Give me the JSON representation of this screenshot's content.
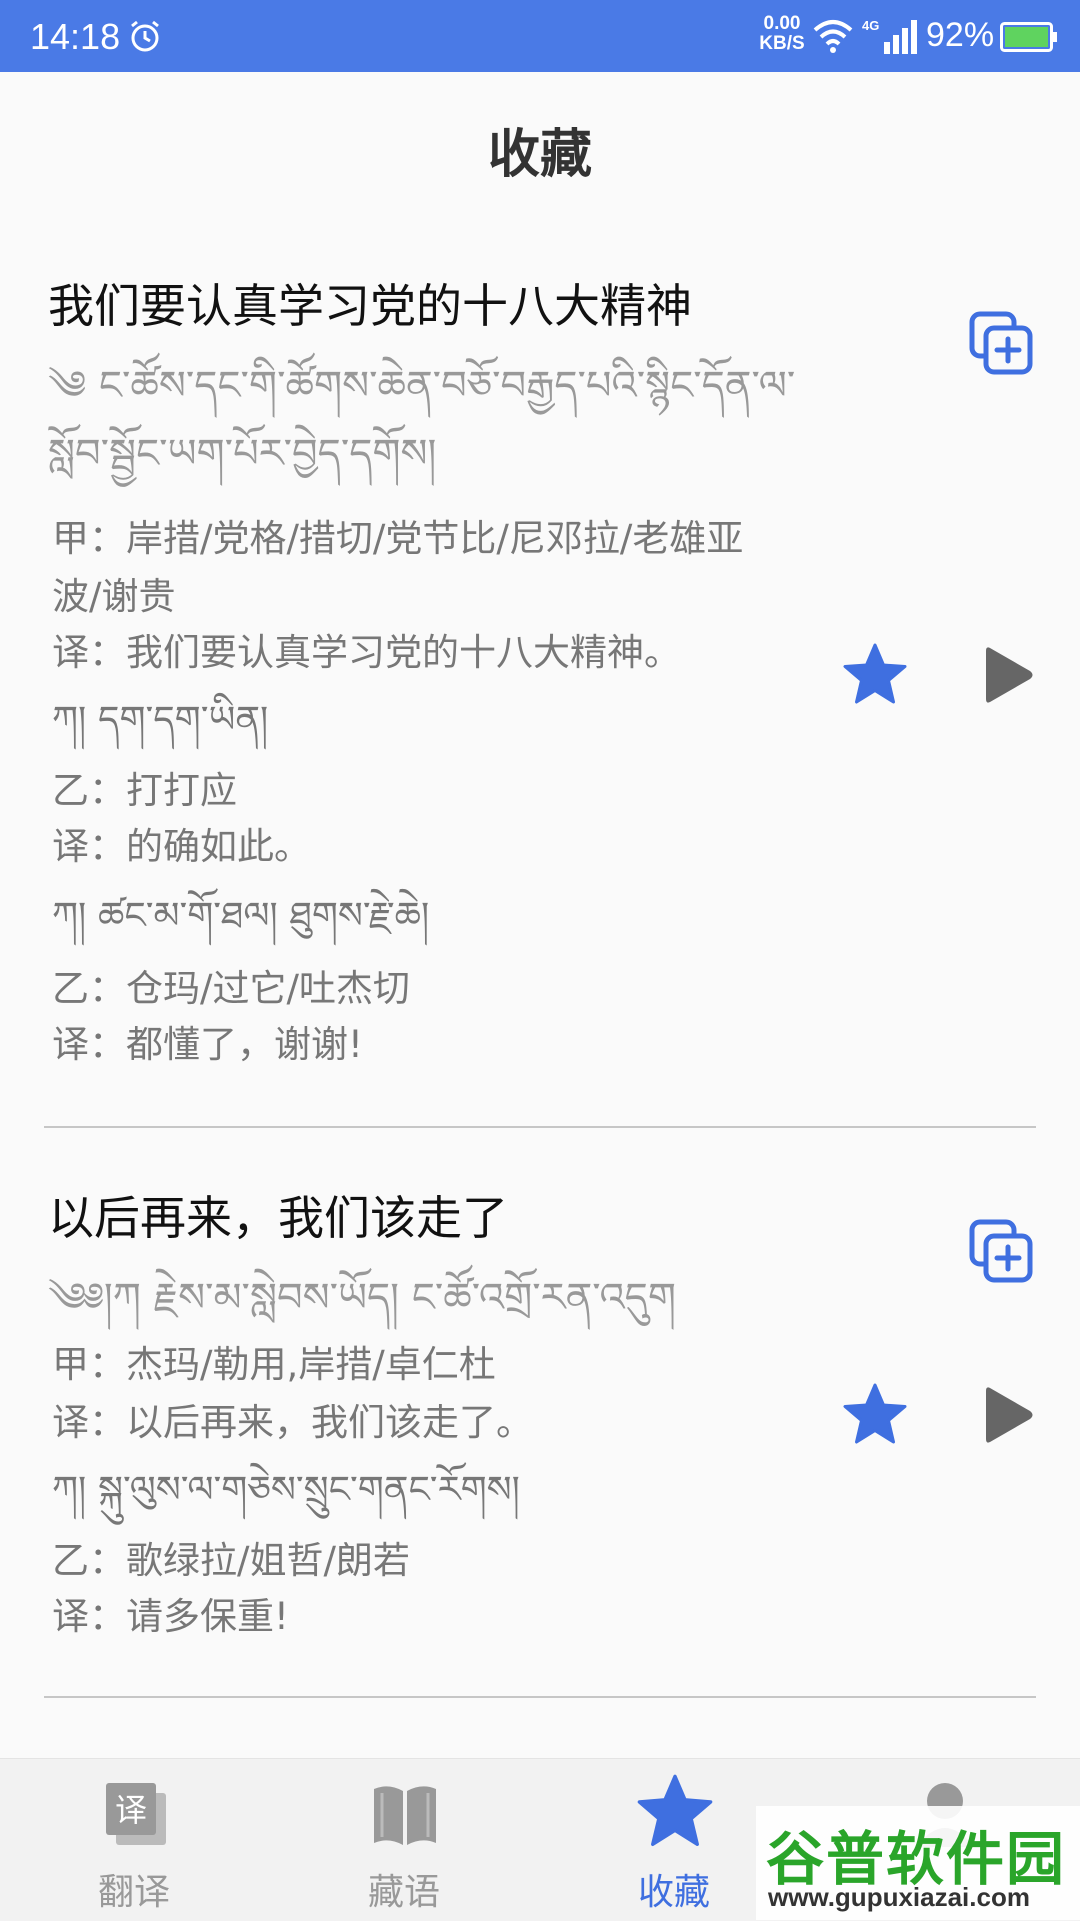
{
  "status_bar": {
    "time": "14:18",
    "net_speed_value": "0.00",
    "net_speed_unit": "KB/S",
    "battery": "92%"
  },
  "page": {
    "title": "收藏"
  },
  "items": [
    {
      "title": "我们要认真学习党的十八大精神",
      "tibetan_title_1": "༄   ང་ཚོས་དང་གི་ཚོགས་ཆེན་བཅོ་བརྒྱད་པའི་སྙིང་དོན་ལ་",
      "tibetan_title_2": "སློབ་སྦྱོང་ཡག་པོར་བྱེད་དགོས།",
      "lines": [
        "甲：岸措/党格/措切/党节比/尼邓拉/老雄亚",
        "波/谢贵",
        "译：我们要认真学习党的十八大精神。",
        "ཀ།    དག་དག་ཡིན།",
        "乙：打打应",
        "译：的确如此。",
        "ཀ།    ཚང་མ་གོ་ཐལ།    ཐུགས་རྗེ་ཆེ།",
        "乙：仓玛/过它/吐杰切",
        "译：都懂了，谢谢!"
      ]
    },
    {
      "title": "以后再来，我们该走了",
      "tibetan_title_1": "༄༅།ཀ   རྗེས་མ་སླེབས་ཡོད།        ང་ཚོ་འགྲོ་རན་འདུག",
      "lines": [
        "甲：杰玛/勒用,岸措/卓仁杜",
        "译：以后再来，我们该走了。",
        "ཀ།    སྐུ་ལུས་ལ་གཅེས་སྲུང་གནང་རོགས།",
        "乙：歌绿拉/姐哲/朗若",
        "译：请多保重!"
      ]
    }
  ],
  "nav": [
    {
      "label": "翻译",
      "icon": "translate-icon",
      "active": false
    },
    {
      "label": "藏语",
      "icon": "book-icon",
      "active": false
    },
    {
      "label": "收藏",
      "icon": "star-icon",
      "active": true
    },
    {
      "label": "",
      "icon": "profile-icon",
      "active": false
    }
  ],
  "watermark": {
    "brand": "谷普软件园",
    "url": "www.gupuxiazai.com"
  },
  "icons": {
    "copy": "copy-add-icon",
    "star": "star-icon",
    "play": "play-icon"
  },
  "colors": {
    "status_bar": "#4a7ae6",
    "accent": "#3f6fe0",
    "play": "#666666",
    "text_muted": "#777777"
  }
}
